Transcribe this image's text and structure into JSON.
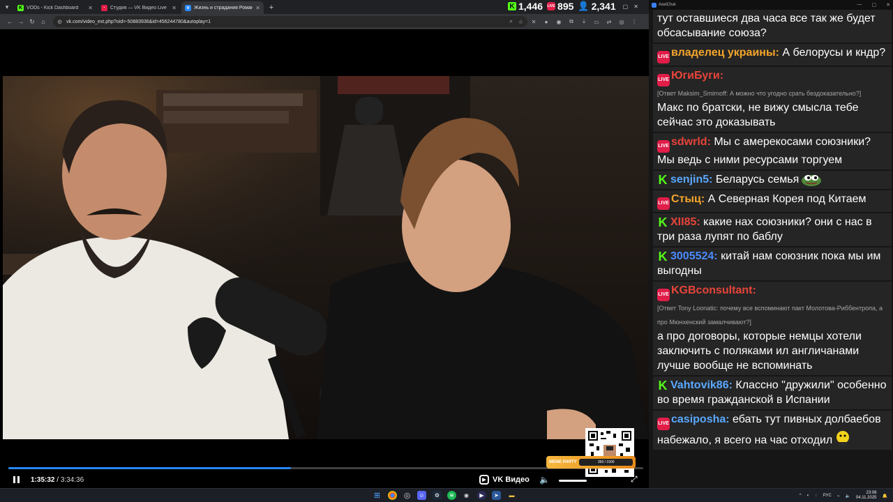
{
  "browser": {
    "tabs": [
      {
        "title": "VODs - Kick Dashboard",
        "icon": "kick-icon",
        "color": "#53fc18"
      },
      {
        "title": "Студия — VK Видео Live",
        "icon": "vk-live-icon",
        "color": "#e11d48"
      },
      {
        "title": "Жизнь и страдания Романа",
        "icon": "vk-icon",
        "color": "#2787f5",
        "active": true
      }
    ],
    "url": "vk.com/video_ext.php?oid=-50883936&id=456244780&autoplay=1"
  },
  "stats": {
    "kick_viewers": "1,446",
    "vk_viewers": "895",
    "total_viewers": "2,341"
  },
  "player": {
    "current_time": "1:35:32",
    "separator": " / ",
    "duration": "3:34:36",
    "progress": 0.445,
    "brand": "VK Видео",
    "meme_party_title": "MEME PARTY",
    "meme_party_counter": "350 / 1500"
  },
  "chat": {
    "window_title": "AxelChat",
    "messages": [
      {
        "platform": "none",
        "user": "",
        "user_color": "#ffffff",
        "text": "тут оставшиеся два часа все так же будет обсасывание союза?"
      },
      {
        "platform": "vk",
        "user": "владелец украины:",
        "user_color": "#f4a52b",
        "text": "А белорусы и кндр?"
      },
      {
        "platform": "vk",
        "user": "ЮгиБуги:",
        "user_color": "#e8443a",
        "reply": "[Ответ Maksim_Smirnoff: А можно что угодно срать бездоказательно?]",
        "text": "Макс по братски, не вижу смысла тебе сейчас это доказывать"
      },
      {
        "platform": "vk",
        "user": "sdwrld:",
        "user_color": "#e8443a",
        "text": "Мы с амерекосами союзники? Мы ведь с ними ресурсами торгуем"
      },
      {
        "platform": "kick",
        "user": "senjin5:",
        "user_color": "#5aa8ff",
        "text": "Беларусь семья",
        "emote": "pepe"
      },
      {
        "platform": "vk",
        "user": "Стыц:",
        "user_color": "#f4a52b",
        "text": "А Северная Корея под Китаем"
      },
      {
        "platform": "kick",
        "user": "XII85:",
        "user_color": "#e8443a",
        "text": "какие нах союзники? они с нас в три раза лупят по баблу"
      },
      {
        "platform": "kick",
        "user": "3005524:",
        "user_color": "#4a8bff",
        "text": "китай нам союзник пока мы им выгодны"
      },
      {
        "platform": "vk",
        "user": "KGBconsultant:",
        "user_color": "#e8443a",
        "reply": "[Ответ Tony Loonatic: почему все вспоминают пакт Молотова-Риббентропа, а про Мюнхенский замалчивают?]",
        "text": "а про договоры, которые немцы хотели заключить с поляками ил англичанами лучше вообще не вспоминать"
      },
      {
        "platform": "kick",
        "user": "Vahtovik86:",
        "user_color": "#5aa8ff",
        "text": "Классно \"дружили\" особенно во время гражданской в Испании"
      },
      {
        "platform": "vk",
        "user": "casiposha:",
        "user_color": "#5aa8ff",
        "text": "ебать тут пивных долбаебов набежало, я всего на час отходил",
        "emote": "emoji"
      }
    ]
  },
  "taskbar": {
    "lang": "РУС",
    "time": "23:08",
    "date": "04.11.2025"
  }
}
